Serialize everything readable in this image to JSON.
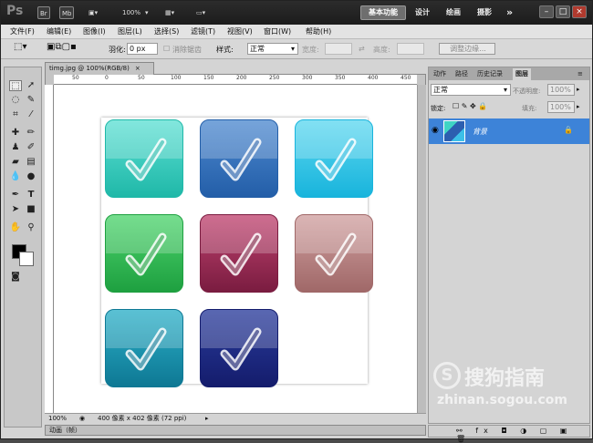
{
  "titlebar": {
    "logo": "Ps",
    "br": "Br",
    "mb": "Mb",
    "zoom": "100%",
    "workspace_active": "基本功能",
    "workspaces": [
      "设计",
      "绘画",
      "摄影"
    ],
    "more": "»"
  },
  "menu": [
    "文件(F)",
    "编辑(E)",
    "图像(I)",
    "图层(L)",
    "选择(S)",
    "滤镜(T)",
    "视图(V)",
    "窗口(W)",
    "帮助(H)"
  ],
  "options": {
    "feather_label": "羽化:",
    "feather_value": "0 px",
    "antialias_label": "消除锯齿",
    "style_label": "样式:",
    "style_value": "正常",
    "width_label": "宽度:",
    "height_label": "高度:",
    "refine_button": "调整边缘..."
  },
  "document": {
    "tab_title": "timg.jpg @ 100%(RGB/8)",
    "ruler_marks": [
      "50",
      "0",
      "50",
      "100",
      "150",
      "200",
      "250",
      "300",
      "350",
      "400",
      "450"
    ],
    "zoom": "100%",
    "size_info": "400 像素 x 402 像素 (72 ppi)",
    "animation_label": "动画（帧）"
  },
  "icons": [
    {
      "color_top": "#5fe0d4",
      "color_bottom": "#1fb8a8"
    },
    {
      "color_top": "#4f8ad0",
      "color_bottom": "#235ea8"
    },
    {
      "color_top": "#5fd8f0",
      "color_bottom": "#18b4dc"
    },
    {
      "color_top": "#4ed46e",
      "color_bottom": "#1ea040"
    },
    {
      "color_top": "#c04470",
      "color_bottom": "#7a1c40"
    },
    {
      "color_top": "#d0a0a0",
      "color_bottom": "#a06868"
    },
    {
      "color_top": "#2cb0c8",
      "color_bottom": "#0e7894"
    },
    {
      "color_top": "#2a3c9c",
      "color_bottom": "#141c6c"
    }
  ],
  "panel": {
    "tabs": [
      "动作",
      "路径",
      "历史记录",
      "图层"
    ],
    "active_tab": "图层",
    "blend_mode": "正常",
    "opacity_label": "不透明度:",
    "opacity_value": "100%",
    "lock_label": "锁定:",
    "fill_label": "填充:",
    "fill_value": "100%",
    "layer_name": "背景"
  },
  "watermark": {
    "brand": "搜狗指南",
    "url": "zhinan.sogou.com"
  }
}
